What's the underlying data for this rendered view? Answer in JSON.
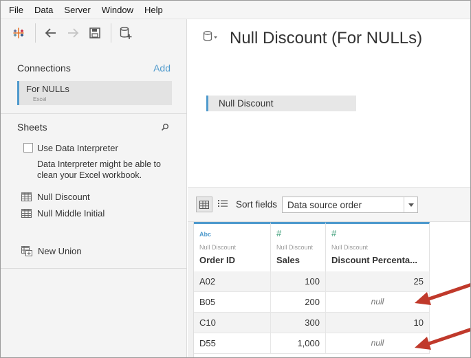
{
  "menu": [
    "File",
    "Data",
    "Server",
    "Window",
    "Help"
  ],
  "connections": {
    "title": "Connections",
    "add_label": "Add",
    "items": [
      {
        "name": "For NULLs",
        "type": "Excel"
      }
    ]
  },
  "sheets": {
    "title": "Sheets",
    "use_interpreter_label": "Use Data Interpreter",
    "interpreter_desc": "Data Interpreter might be able to clean your Excel workbook.",
    "items": [
      "Null Discount",
      "Null Middle Initial"
    ],
    "new_union_label": "New Union"
  },
  "datasource": {
    "title": "Null Discount (For NULLs)",
    "canvas_table": "Null Discount"
  },
  "grid_toolbar": {
    "sort_label": "Sort fields",
    "sort_value": "Data source order"
  },
  "columns": [
    {
      "type": "Abc",
      "source": "Null Discount",
      "name": "Order ID"
    },
    {
      "type": "#",
      "source": "Null Discount",
      "name": "Sales"
    },
    {
      "type": "#",
      "source": "Null Discount",
      "name": "Discount Percenta..."
    }
  ],
  "rows": [
    {
      "order_id": "A02",
      "sales": "100",
      "discount": "25"
    },
    {
      "order_id": "B05",
      "sales": "200",
      "discount": "null"
    },
    {
      "order_id": "C10",
      "sales": "300",
      "discount": "10"
    },
    {
      "order_id": "D55",
      "sales": "1,000",
      "discount": "null"
    }
  ],
  "colors": {
    "accent": "#4f9acd",
    "number_type": "#3f9f7a",
    "annotation_arrow": "#c0392b"
  }
}
